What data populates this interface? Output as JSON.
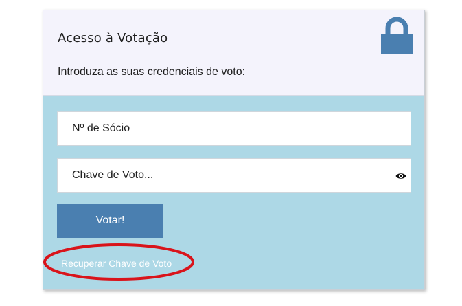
{
  "header": {
    "title": "Acesso à Votação",
    "subtitle": "Introduza as suas credenciais de voto:",
    "icon": "lock-icon"
  },
  "form": {
    "member_field": {
      "placeholder": "Nº de Sócio",
      "value": ""
    },
    "key_field": {
      "placeholder": "Chave de Voto...",
      "value": "",
      "toggle_icon": "eye-icon"
    },
    "submit_label": "Votar!",
    "recover_link": "Recuperar Chave de Voto"
  },
  "colors": {
    "header_bg": "#f4f3fc",
    "body_bg": "#add8e6",
    "accent": "#4a7fb0",
    "annotation": "#d9141b"
  }
}
